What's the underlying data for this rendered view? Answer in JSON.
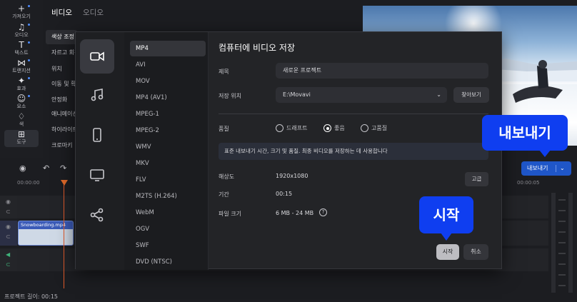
{
  "rail": {
    "items": [
      {
        "label": "가져오기",
        "icon": "plus-icon",
        "glyph": "+"
      },
      {
        "label": "오디오",
        "icon": "music-note-icon",
        "glyph": "♫"
      },
      {
        "label": "텍스트",
        "icon": "text-icon",
        "glyph": "T"
      },
      {
        "label": "트랜지션",
        "icon": "transition-icon",
        "glyph": "⋈"
      },
      {
        "label": "효과",
        "icon": "sparkle-icon",
        "glyph": "✦"
      },
      {
        "label": "요소",
        "icon": "sticker-icon",
        "glyph": "☺"
      },
      {
        "label": "색",
        "icon": "color-bucket-icon",
        "glyph": "♢"
      },
      {
        "label": "도구",
        "icon": "tools-icon",
        "glyph": "⊞"
      }
    ]
  },
  "panel": {
    "tabs": {
      "video": "비디오",
      "audio": "오디오"
    },
    "options": [
      "색상 조정",
      "자르고 회전",
      "위치",
      "이동 및 확대",
      "안정화",
      "애니메이션",
      "하이라이트",
      "크로마키"
    ]
  },
  "dialog": {
    "title": "컴퓨터에 비디오 저장",
    "categories": [
      "video-camera-icon",
      "music-note-icon",
      "phone-icon",
      "monitor-icon",
      "share-icon"
    ],
    "formats": [
      "MP4",
      "AVI",
      "MOV",
      "MP4 (AV1)",
      "MPEG-1",
      "MPEG-2",
      "WMV",
      "MKV",
      "FLV",
      "M2TS (H.264)",
      "WebM",
      "OGV",
      "SWF",
      "DVD (NTSC)"
    ],
    "name_label": "제목",
    "name_value": "새로운 프로젝트",
    "path_label": "저장 위치",
    "path_value": "E:\\Movavi",
    "browse_label": "찾아보기",
    "quality_label": "품질",
    "quality_options": {
      "draft": "드래프트",
      "good": "좋음",
      "high": "고품질"
    },
    "quality_selected": "좋음",
    "quality_note": "표준 내보내기 시간, 크기 및 품질. 최종 비디오를 저장하는 데 사용합니다",
    "resolution_label": "해상도",
    "resolution_value": "1920x1080",
    "advanced_label": "고급",
    "duration_label": "기간",
    "duration_value": "00:15",
    "filesize_label": "파일 크기",
    "filesize_value": "6 MB - 24 MB",
    "help_glyph": "?",
    "start_label": "시작",
    "cancel_label": "취소"
  },
  "export_button": {
    "label": "내보내기",
    "chevron": "⌄"
  },
  "timeline": {
    "ruler": [
      "00:00:00",
      "00:00:05"
    ],
    "clip_name": "Snowboarding.mp4",
    "status": "프로젝트 길이: 00:15"
  },
  "callouts": {
    "export": "내보내기",
    "start": "시작"
  },
  "colors": {
    "accent": "#1f56c8",
    "callout": "#0f3ef0",
    "playhead": "#e05a2a"
  }
}
